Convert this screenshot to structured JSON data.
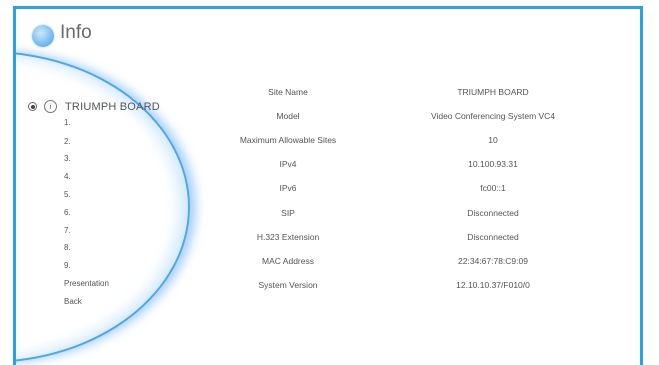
{
  "header": {
    "title": "Info"
  },
  "sidebar": {
    "title": "TRIUMPH BOARD",
    "items": [
      {
        "label": "1."
      },
      {
        "label": "2."
      },
      {
        "label": "3."
      },
      {
        "label": "4."
      },
      {
        "label": "5."
      },
      {
        "label": "6."
      },
      {
        "label": "7."
      },
      {
        "label": "8."
      },
      {
        "label": "9."
      },
      {
        "label": "Presentation"
      },
      {
        "label": "Back"
      }
    ]
  },
  "info": {
    "rows": [
      {
        "label": "Site Name",
        "value": "TRIUMPH BOARD"
      },
      {
        "label": "Model",
        "value": "Video Conferencing System VC4"
      },
      {
        "label": "Maximum Allowable Sites",
        "value": "10"
      },
      {
        "label": "IPv4",
        "value": "10.100.93.31"
      },
      {
        "label": "IPv6",
        "value": "fc00::1"
      },
      {
        "label": "SIP",
        "value": "Disconnected"
      },
      {
        "label": "H.323 Extension",
        "value": "Disconnected"
      },
      {
        "label": "MAC Address",
        "value": "22:34:67:78:C9:09"
      },
      {
        "label": "System Version",
        "value": "12.10.10.37/F010/0"
      }
    ]
  },
  "colors": {
    "frame": "#29a3e6",
    "accent": "#4fa6e6"
  }
}
